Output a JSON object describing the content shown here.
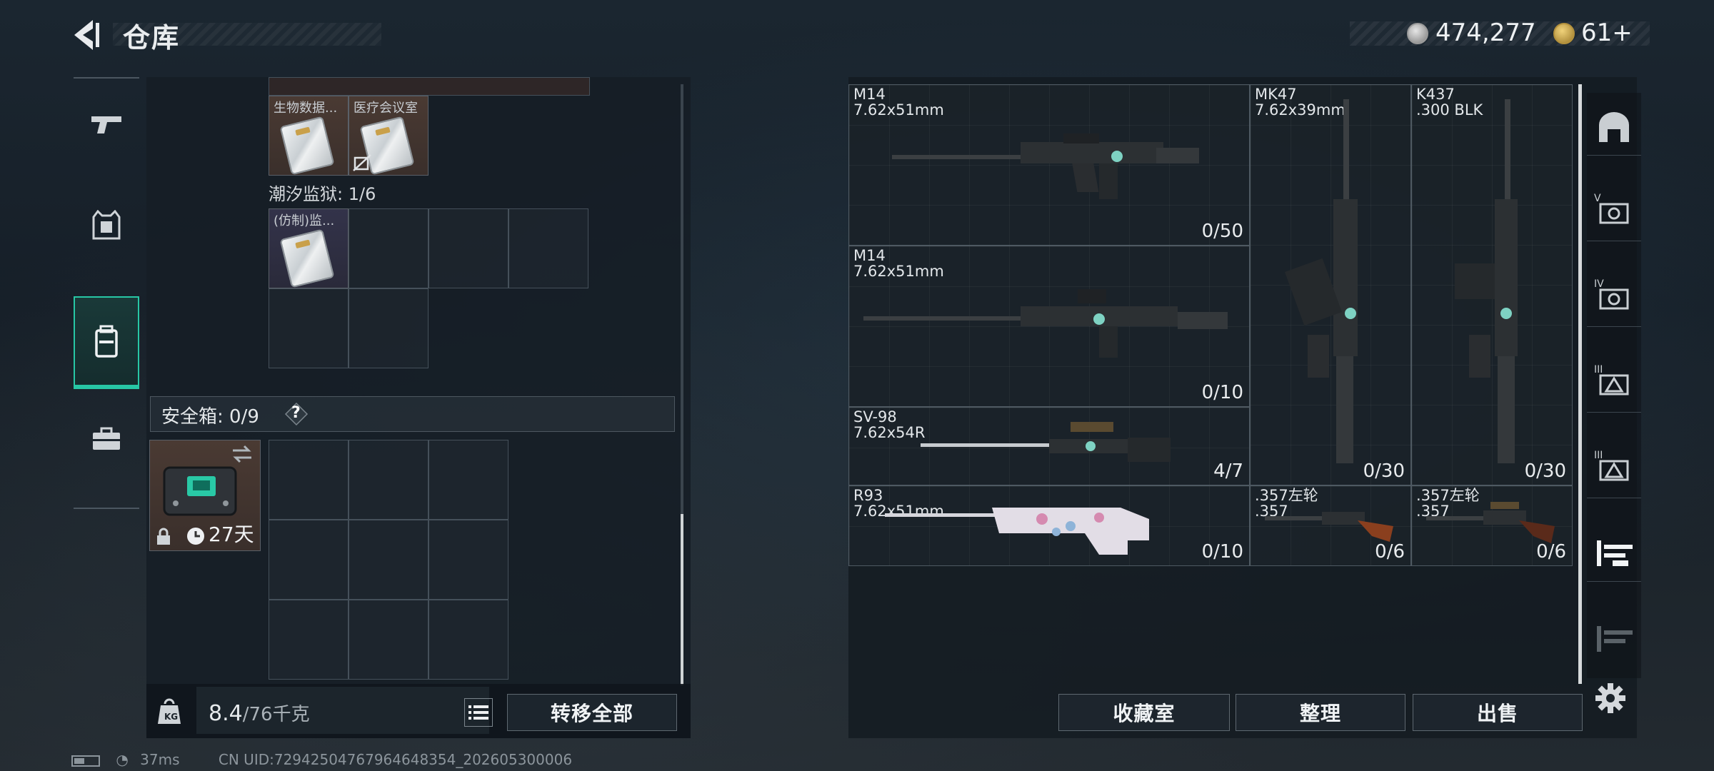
{
  "header": {
    "title": "仓库",
    "currency_primary": "474,277",
    "currency_secondary": "61+"
  },
  "backpack": {
    "items_top": [
      {
        "label": "生物数据..."
      },
      {
        "label": "医疗会议室"
      }
    ],
    "prison_label": "潮汐监狱: 1/6",
    "prison_item": {
      "label": "(仿制)监..."
    },
    "safebox_label": "安全箱: 0/9",
    "safebox_help": "?",
    "safebox_timer": "27天",
    "weight_current": "8.4",
    "weight_max": "/76千克",
    "transfer_all": "转移全部"
  },
  "weapons": [
    {
      "name": "M14\n7.62x51mm",
      "count": "0/50"
    },
    {
      "name": "MK47\n7.62x39mm",
      "count": "0/30"
    },
    {
      "name": "K437\n.300 BLK",
      "count": "0/30"
    },
    {
      "name": "M14\n7.62x51mm",
      "count": "0/10"
    },
    {
      "name": "SV-98\n7.62x54R",
      "count": "4/7"
    },
    {
      "name": "R93\n7.62x51mm",
      "count": "0/10"
    },
    {
      "name": ".357左轮\n.357",
      "count": "0/6"
    },
    {
      "name": ".357左轮\n.357",
      "count": "0/6"
    }
  ],
  "actions": {
    "collection": "收藏室",
    "organize": "整理",
    "sell": "出售"
  },
  "right_tabs": [
    "V",
    "IV",
    "III",
    "III"
  ],
  "status": {
    "ping": "37ms",
    "uid": "CN UID:7294250476796464835​4_202605300006"
  },
  "colors": {
    "accent": "#27c7a5",
    "panel": "#161e25"
  }
}
